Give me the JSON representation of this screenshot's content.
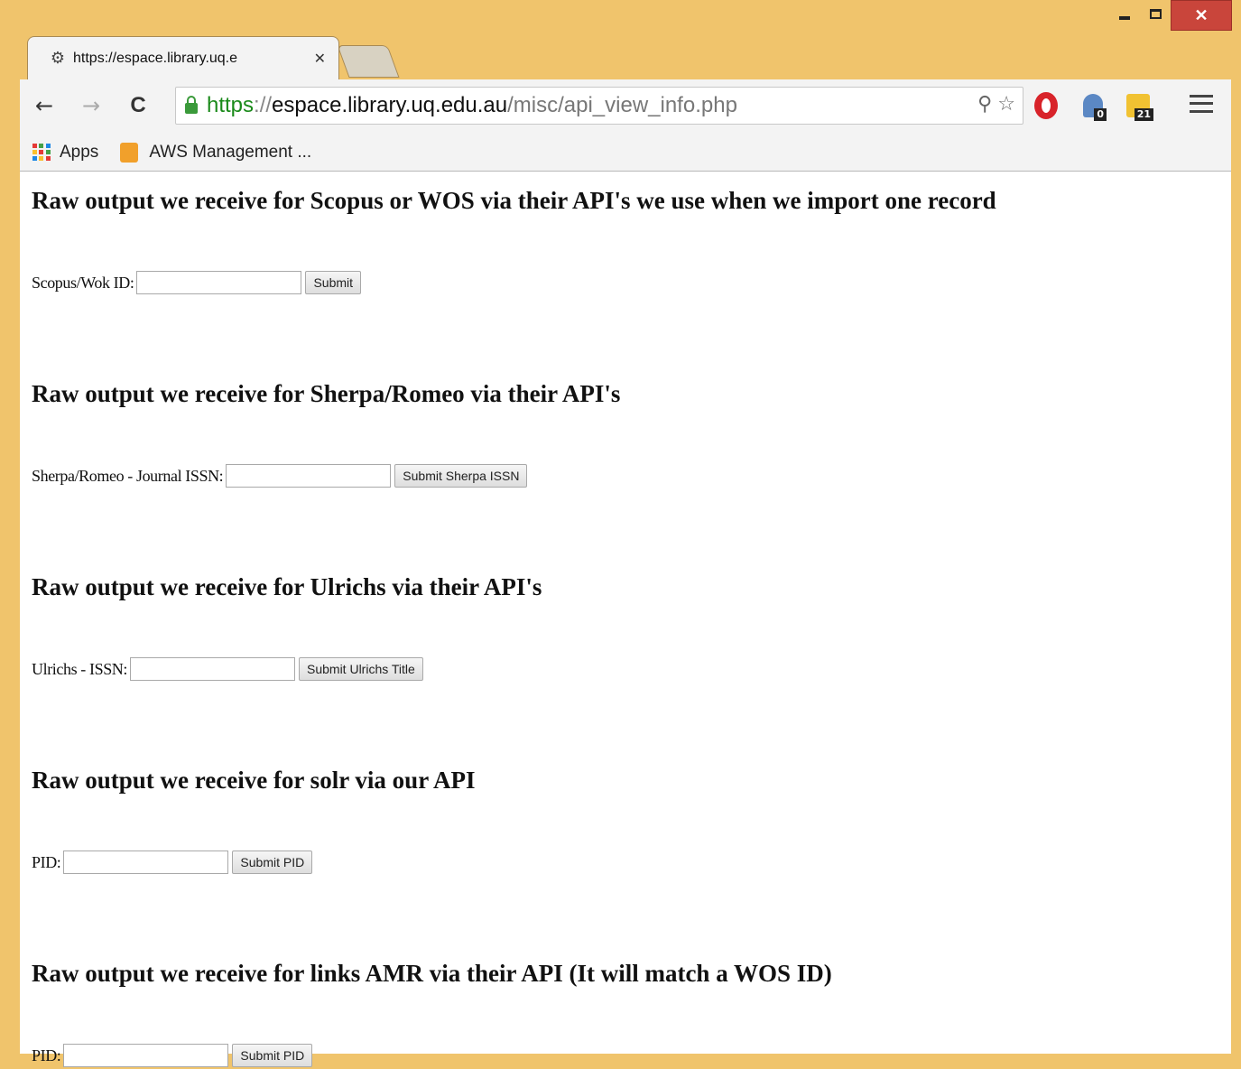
{
  "window": {
    "controls": {
      "minimize": "‒",
      "maximize": "□",
      "close": "✕"
    }
  },
  "tab": {
    "title": "https://espace.library.uq.e",
    "close": "✕"
  },
  "toolbar": {
    "back": "←",
    "forward": "→",
    "reload": "C",
    "url": {
      "scheme": "https",
      "sep": "://",
      "host": "espace.library.uq.edu.au",
      "path": "/misc/api_view_info.php"
    },
    "zoom_icon": "⚲",
    "star_icon": "☆",
    "ghostery_badge": "0",
    "mail_badge": "21"
  },
  "bookmarks": {
    "apps": "Apps",
    "aws": "AWS Management ..."
  },
  "sections": [
    {
      "heading": "Raw output we receive for Scopus or WOS via their API's we use when we import one record",
      "label": "Scopus/Wok ID:",
      "value": "",
      "button": "Submit"
    },
    {
      "heading": "Raw output we receive for Sherpa/Romeo via their API's",
      "label": "Sherpa/Romeo - Journal ISSN:",
      "value": "",
      "button": "Submit Sherpa ISSN"
    },
    {
      "heading": "Raw output we receive for Ulrichs via their API's",
      "label": "Ulrichs - ISSN:",
      "value": "",
      "button": "Submit Ulrichs Title"
    },
    {
      "heading": "Raw output we receive for solr via our API",
      "label": "PID:",
      "value": "",
      "button": "Submit PID"
    },
    {
      "heading": "Raw output we receive for links AMR via their API (It will match a WOS ID)",
      "label": "PID:",
      "value": "",
      "button": "Submit PID"
    }
  ],
  "colors": {
    "frame": "#f0c46c",
    "close_button": "#c9453b",
    "secure_green": "#1a8a1a"
  }
}
